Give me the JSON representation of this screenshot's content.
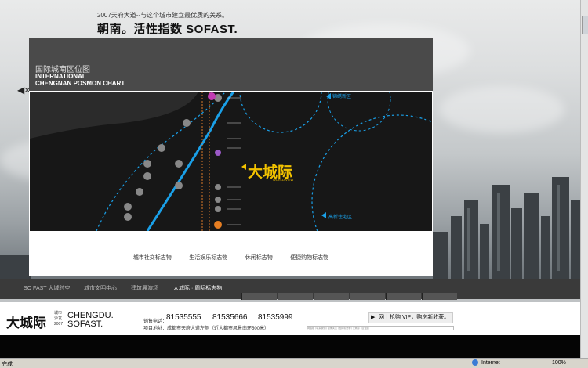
{
  "header": {
    "tagline": "2007天府大道--与这个城市建立最优质的关系。",
    "headline": "朝南。活性指数 SOFAST."
  },
  "panel": {
    "title_cn": "国际城南区位图",
    "title_en_1": "INTERNATIONAL",
    "title_en_2": "CHENGNAN POSMON CHART",
    "nav_arrow": "◀×"
  },
  "map": {
    "brand_label": "大城际",
    "brand_sub": "WORLD VIEW",
    "labels": {
      "right_top": "锦绣新区",
      "right_mid": "高新住宅区"
    }
  },
  "panel_links": [
    "城市社交标志物",
    "生活娱乐标志物",
    "休闲标志物",
    "便捷购物标志物"
  ],
  "navbar": {
    "tabs": [
      "SO FAST 大城时空",
      "城市文明中心",
      "建筑展演场",
      "大城际 · 周际标志物"
    ],
    "active": 3
  },
  "footer": {
    "logo_cn": "大城际",
    "logo_sub_1": "城市",
    "logo_sub_2": "沙发",
    "logo_sub_3": "2007",
    "logo_en_1": "CHENGDU.",
    "logo_en_2": "SOFAST.",
    "phone_label": "销售电话：",
    "phones": [
      "81535555",
      "81535666",
      "81535999"
    ],
    "address": "项目地址：成都市天府大道左侧（近大都市风景南环500米）",
    "vip_text": "网上抢购 VIP，购房新收获。",
    "small_links": "网络版  |  联系我们  |  媒体关注  |  国际标志物  |  大城际 · 区位图"
  },
  "statusbar": {
    "left": "完成",
    "internet": "Internet",
    "zoom": "100%"
  },
  "colors": {
    "accent_blue": "#1aa0e8",
    "accent_yellow": "#f2c200",
    "accent_purple": "#9b59c7"
  }
}
